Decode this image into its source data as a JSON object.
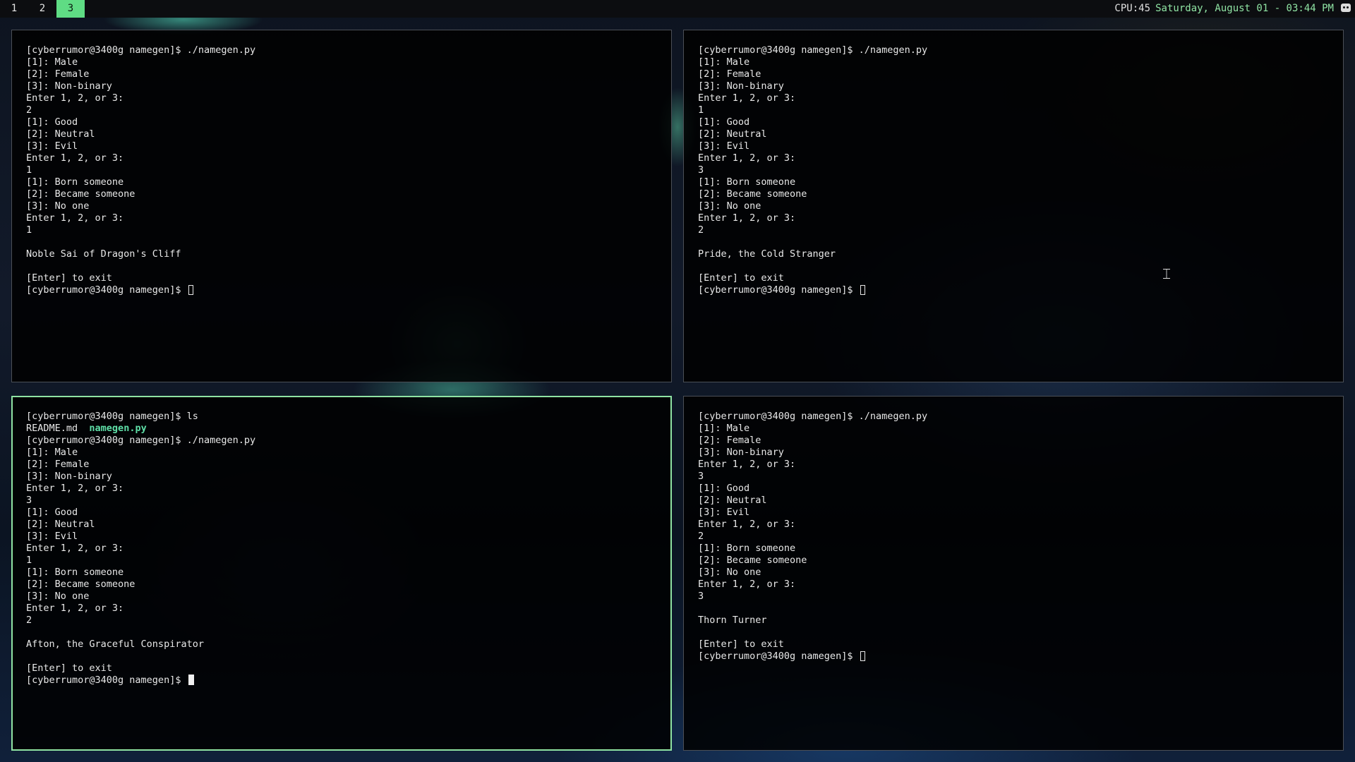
{
  "topbar": {
    "workspaces": [
      "1",
      "2",
      "3"
    ],
    "active_workspace": "3",
    "cpu": "CPU:45",
    "datetime": "Saturday, August 01 - 03:44 PM",
    "tray_icon": "discord-icon"
  },
  "terminals": {
    "top_left": {
      "lines": [
        "[cyberrumor@3400g namegen]$ ./namegen.py",
        "[1]: Male",
        "[2]: Female",
        "[3]: Non-binary",
        "Enter 1, 2, or 3:",
        "2",
        "[1]: Good",
        "[2]: Neutral",
        "[3]: Evil",
        "Enter 1, 2, or 3:",
        "1",
        "[1]: Born someone",
        "[2]: Became someone",
        "[3]: No one",
        "Enter 1, 2, or 3:",
        "1",
        "",
        "Noble Sai of Dragon's Cliff",
        "",
        "[Enter] to exit"
      ],
      "prompt": "[cyberrumor@3400g namegen]$ "
    },
    "top_right": {
      "lines": [
        "[cyberrumor@3400g namegen]$ ./namegen.py",
        "[1]: Male",
        "[2]: Female",
        "[3]: Non-binary",
        "Enter 1, 2, or 3:",
        "1",
        "[1]: Good",
        "[2]: Neutral",
        "[3]: Evil",
        "Enter 1, 2, or 3:",
        "3",
        "[1]: Born someone",
        "[2]: Became someone",
        "[3]: No one",
        "Enter 1, 2, or 3:",
        "2",
        "",
        "Pride, the Cold Stranger",
        "",
        "[Enter] to exit"
      ],
      "prompt": "[cyberrumor@3400g namegen]$ "
    },
    "bottom_left": {
      "first_line": "[cyberrumor@3400g namegen]$ ls",
      "ls_file": "README.md",
      "ls_exec": "namegen.py",
      "lines": [
        "[cyberrumor@3400g namegen]$ ./namegen.py",
        "[1]: Male",
        "[2]: Female",
        "[3]: Non-binary",
        "Enter 1, 2, or 3:",
        "3",
        "[1]: Good",
        "[2]: Neutral",
        "[3]: Evil",
        "Enter 1, 2, or 3:",
        "1",
        "[1]: Born someone",
        "[2]: Became someone",
        "[3]: No one",
        "Enter 1, 2, or 3:",
        "2",
        "",
        "Afton, the Graceful Conspirator",
        "",
        "[Enter] to exit"
      ],
      "prompt": "[cyberrumor@3400g namegen]$ "
    },
    "bottom_right": {
      "lines": [
        "[cyberrumor@3400g namegen]$ ./namegen.py",
        "[1]: Male",
        "[2]: Female",
        "[3]: Non-binary",
        "Enter 1, 2, or 3:",
        "3",
        "[1]: Good",
        "[2]: Neutral",
        "[3]: Evil",
        "Enter 1, 2, or 3:",
        "2",
        "[1]: Born someone",
        "[2]: Became someone",
        "[3]: No one",
        "Enter 1, 2, or 3:",
        "3",
        "",
        "Thorn Turner",
        "",
        "[Enter] to exit"
      ],
      "prompt": "[cyberrumor@3400g namegen]$ "
    }
  },
  "colors": {
    "accent": "#8fe3a3",
    "active_workspace_bg": "#5fdc84",
    "executable": "#5fe0a8",
    "terminal_bg": "#000000",
    "text": "#e8e8e8"
  }
}
